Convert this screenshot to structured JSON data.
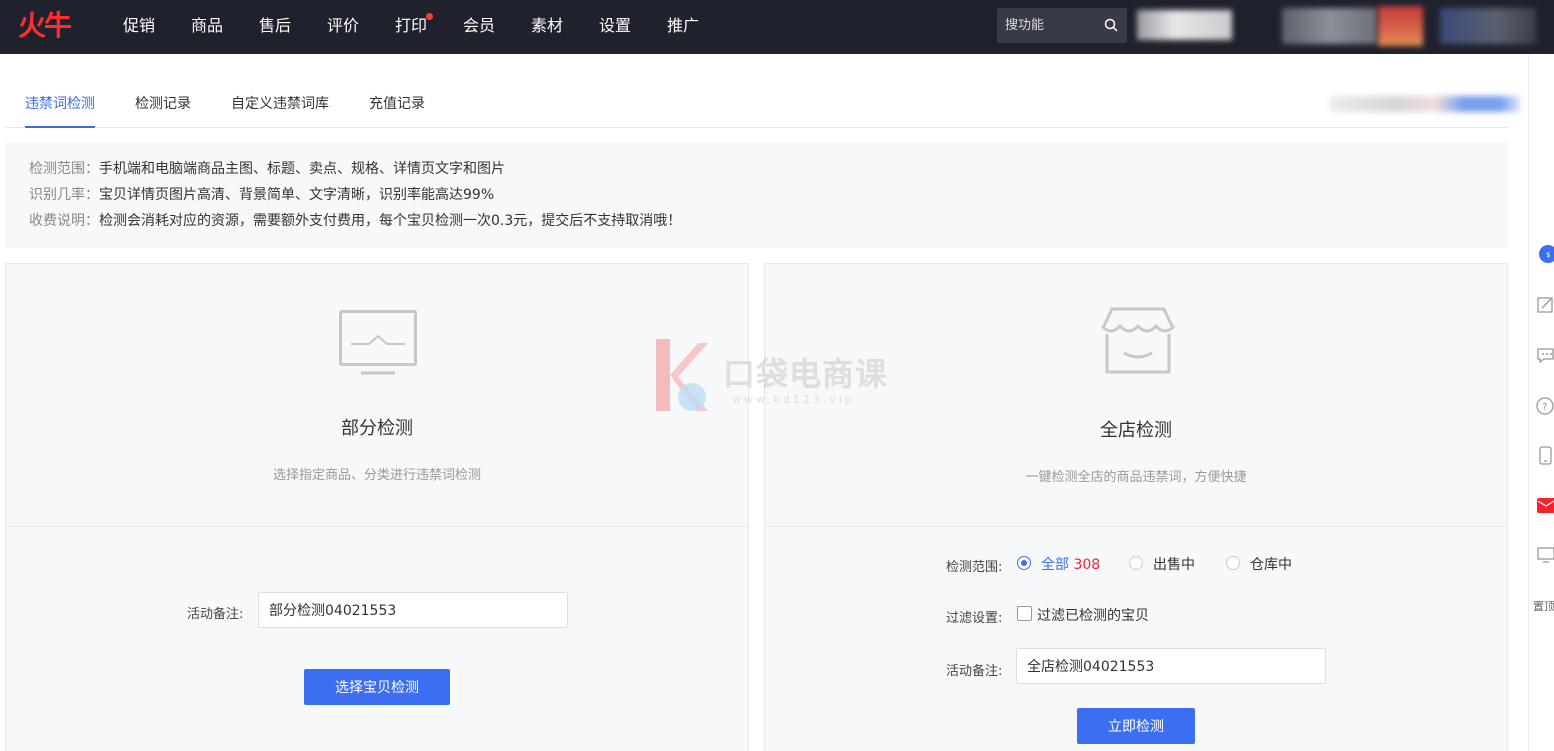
{
  "brand": {
    "logo": "火牛"
  },
  "nav": {
    "items": [
      "促销",
      "商品",
      "售后",
      "评价",
      "打印",
      "会员",
      "素材",
      "设置",
      "推广"
    ],
    "dot_index": 4
  },
  "search": {
    "placeholder": "搜功能"
  },
  "tabs": [
    "违禁词检测",
    "检测记录",
    "自定义违禁词库",
    "充值记录"
  ],
  "info": [
    {
      "k": "检测范围：",
      "v": "手机端和电脑端商品主图、标题、卖点、规格、详情页文字和图片"
    },
    {
      "k": "识别几率：",
      "v": "宝贝详情页图片高清、背景简单、文字清晰，识别率能高达99%"
    },
    {
      "k": "收费说明：",
      "v": "检测会消耗对应的资源，需要额外支付费用，每个宝贝检测一次0.3元，提交后不支持取消哦！"
    }
  ],
  "partial": {
    "title": "部分检测",
    "desc": "选择指定商品、分类进行违禁词检测",
    "note_label": "活动备注:",
    "note_value": "部分检测04021553",
    "button": "选择宝贝检测"
  },
  "full": {
    "title": "全店检测",
    "desc": "一键检测全店的商品违禁词，方便快捷",
    "scope_label": "检测范围:",
    "scope_options": [
      {
        "label": "全部",
        "count": "308",
        "checked": true
      },
      {
        "label": "出售中",
        "checked": false
      },
      {
        "label": "仓库中",
        "checked": false
      }
    ],
    "filter_label": "过滤设置:",
    "filter_option": "过滤已检测的宝贝",
    "filter_checked": false,
    "note_label": "活动备注:",
    "note_value": "全店检测04021553",
    "button": "立即检测"
  },
  "watermark": {
    "text": "口袋电商课",
    "url": "www.kd123.vip"
  },
  "sidebar": {
    "top_label": "置顶"
  },
  "colors": {
    "accent": "#3b6ef0",
    "brand": "#ff2d2d",
    "nav_bg": "#1f222d",
    "count_red": "#f5222d"
  }
}
